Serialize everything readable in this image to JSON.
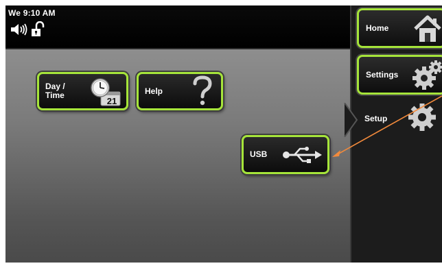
{
  "status": {
    "clock": "We 9:10 AM",
    "speaker_icon": "speaker-icon",
    "lock_icon": "unlocked-padlock-icon"
  },
  "tiles": {
    "daytime": {
      "label": "Day /\nTime",
      "icon": "clock-calendar-icon",
      "calendar_day": "21"
    },
    "help": {
      "label": "Help",
      "icon": "question-mark-icon"
    },
    "usb": {
      "label": "USB",
      "icon": "usb-icon"
    }
  },
  "sidebar": {
    "home": {
      "label": "Home",
      "icon": "house-icon"
    },
    "settings": {
      "label": "Settings",
      "icon": "gears-icon"
    },
    "setup": {
      "label": "Setup",
      "icon": "gear-icon"
    }
  },
  "colors": {
    "accent": "#a6e53a",
    "annotation_arrow": "#f28a3c"
  }
}
